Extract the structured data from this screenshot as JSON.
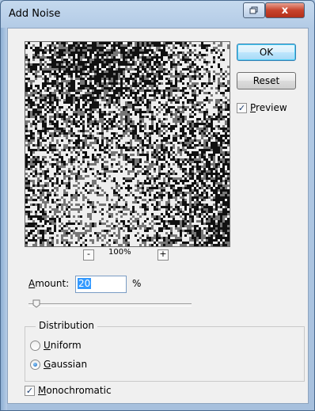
{
  "window": {
    "title": "Add Noise",
    "restore_icon": "restore-icon",
    "close_label": "x"
  },
  "preview": {
    "zoom_level": "100%",
    "zoom_out_label": "-",
    "zoom_in_label": "+"
  },
  "buttons": {
    "ok_label": "OK",
    "reset_label": "Reset"
  },
  "preview_toggle": {
    "first_letter": "P",
    "rest": "review",
    "checked": true
  },
  "amount": {
    "first_letter": "A",
    "rest": "mount:",
    "value": "20",
    "unit": "%",
    "slider_fraction": 0.05
  },
  "distribution": {
    "legend": "Distribution",
    "options": [
      {
        "first_letter": "U",
        "rest": "niform",
        "selected": false
      },
      {
        "first_letter": "G",
        "rest": "aussian",
        "selected": true
      }
    ]
  },
  "monochromatic": {
    "first_letter": "M",
    "rest": "onochromatic",
    "checked": true
  },
  "colors": {
    "accent": "#3399ff",
    "close_button": "#c7432c"
  }
}
